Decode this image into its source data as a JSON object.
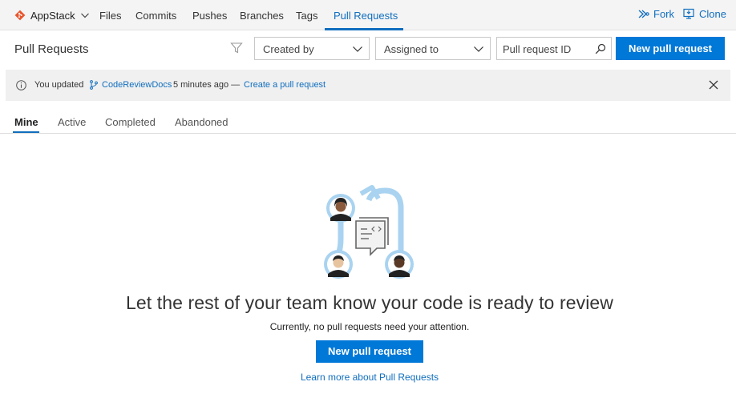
{
  "nav": {
    "repo_name": "AppStack",
    "links": [
      "Files",
      "Commits",
      "Pushes",
      "Branches",
      "Tags",
      "Pull Requests"
    ],
    "active_link": "Pull Requests",
    "fork_label": "Fork",
    "clone_label": "Clone"
  },
  "header": {
    "title": "Pull Requests",
    "created_by": "Created by",
    "assigned_to": "Assigned to",
    "search_placeholder": "Pull request ID",
    "new_pr_label": "New pull request"
  },
  "banner": {
    "prefix": "You updated",
    "branch": "CodeReviewDocs",
    "time": "5 minutes ago —",
    "link": "Create a pull request"
  },
  "tabs": {
    "items": [
      "Mine",
      "Active",
      "Completed",
      "Abandoned"
    ],
    "active": "Mine"
  },
  "empty": {
    "title": "Let the rest of your team know your code is ready to review",
    "subtitle": "Currently, no pull requests need your attention.",
    "button_label": "New pull request",
    "learn_link": "Learn more about Pull Requests"
  },
  "colors": {
    "accent": "#0078d7",
    "link": "#106ebe",
    "repo_icon": "#e8552c",
    "illustration_blue": "#a9d3f0"
  }
}
